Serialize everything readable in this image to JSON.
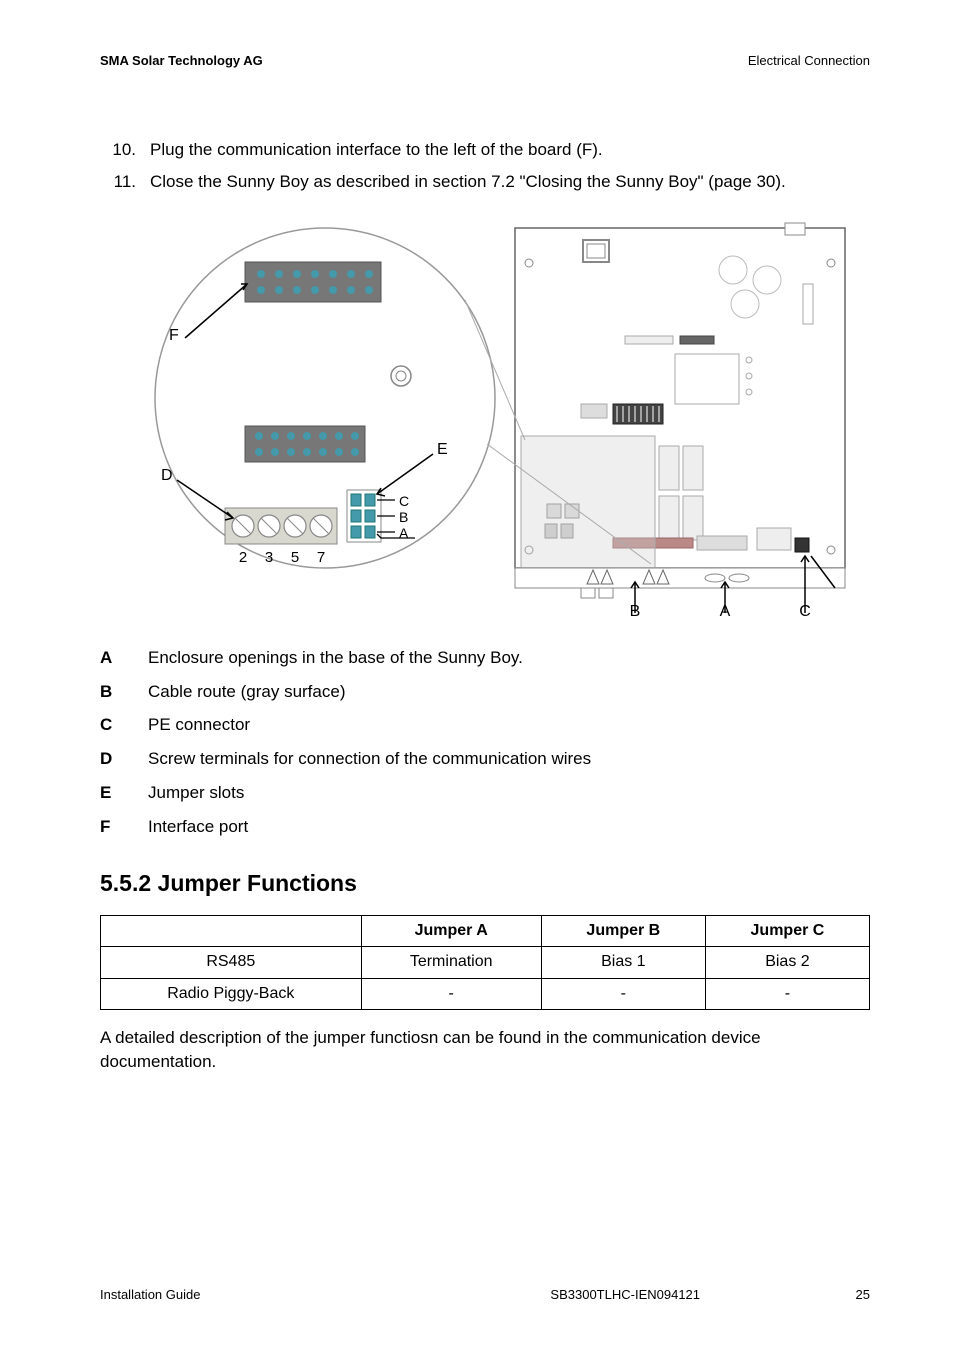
{
  "header": {
    "left": "SMA Solar Technology AG",
    "right": "Electrical Connection"
  },
  "steps": [
    {
      "num": "10.",
      "text": "Plug the communication interface to the left of the board (F)."
    },
    {
      "num": "11.",
      "text": "Close the Sunny Boy as described in section 7.2 \"Closing the Sunny Boy\" (page 30)."
    }
  ],
  "figure": {
    "callout_labels": {
      "F": "F",
      "D": "D",
      "E": "E",
      "C": "C",
      "B": "B",
      "A": "A"
    },
    "terminal_numbers": [
      "2",
      "3",
      "5",
      "7"
    ],
    "board_bottom_labels": {
      "B": "B",
      "A": "A",
      "C": "C"
    }
  },
  "legend": [
    {
      "key": "A",
      "text": "Enclosure openings in the base of the Sunny Boy."
    },
    {
      "key": "B",
      "text": "Cable route (gray surface)"
    },
    {
      "key": "C",
      "text": "PE connector"
    },
    {
      "key": "D",
      "text": "Screw terminals for connection of the communication wires"
    },
    {
      "key": "E",
      "text": "Jumper slots"
    },
    {
      "key": "F",
      "text": "Interface port"
    }
  ],
  "section": {
    "number": "5.5.2",
    "title": "Jumper Functions"
  },
  "jumper_table": {
    "headers": [
      "",
      "Jumper A",
      "Jumper B",
      "Jumper C"
    ],
    "rows": [
      {
        "label": "RS485",
        "a": "Termination",
        "b": "Bias 1",
        "c": "Bias 2"
      },
      {
        "label": "Radio Piggy-Back",
        "a": "-",
        "b": "-",
        "c": "-"
      }
    ]
  },
  "paragraph": "A detailed description of the jumper functiosn can be found in the communication device documentation.",
  "footer": {
    "left": "Installation Guide",
    "doc": "SB3300TLHC-IEN094121",
    "page": "25"
  }
}
